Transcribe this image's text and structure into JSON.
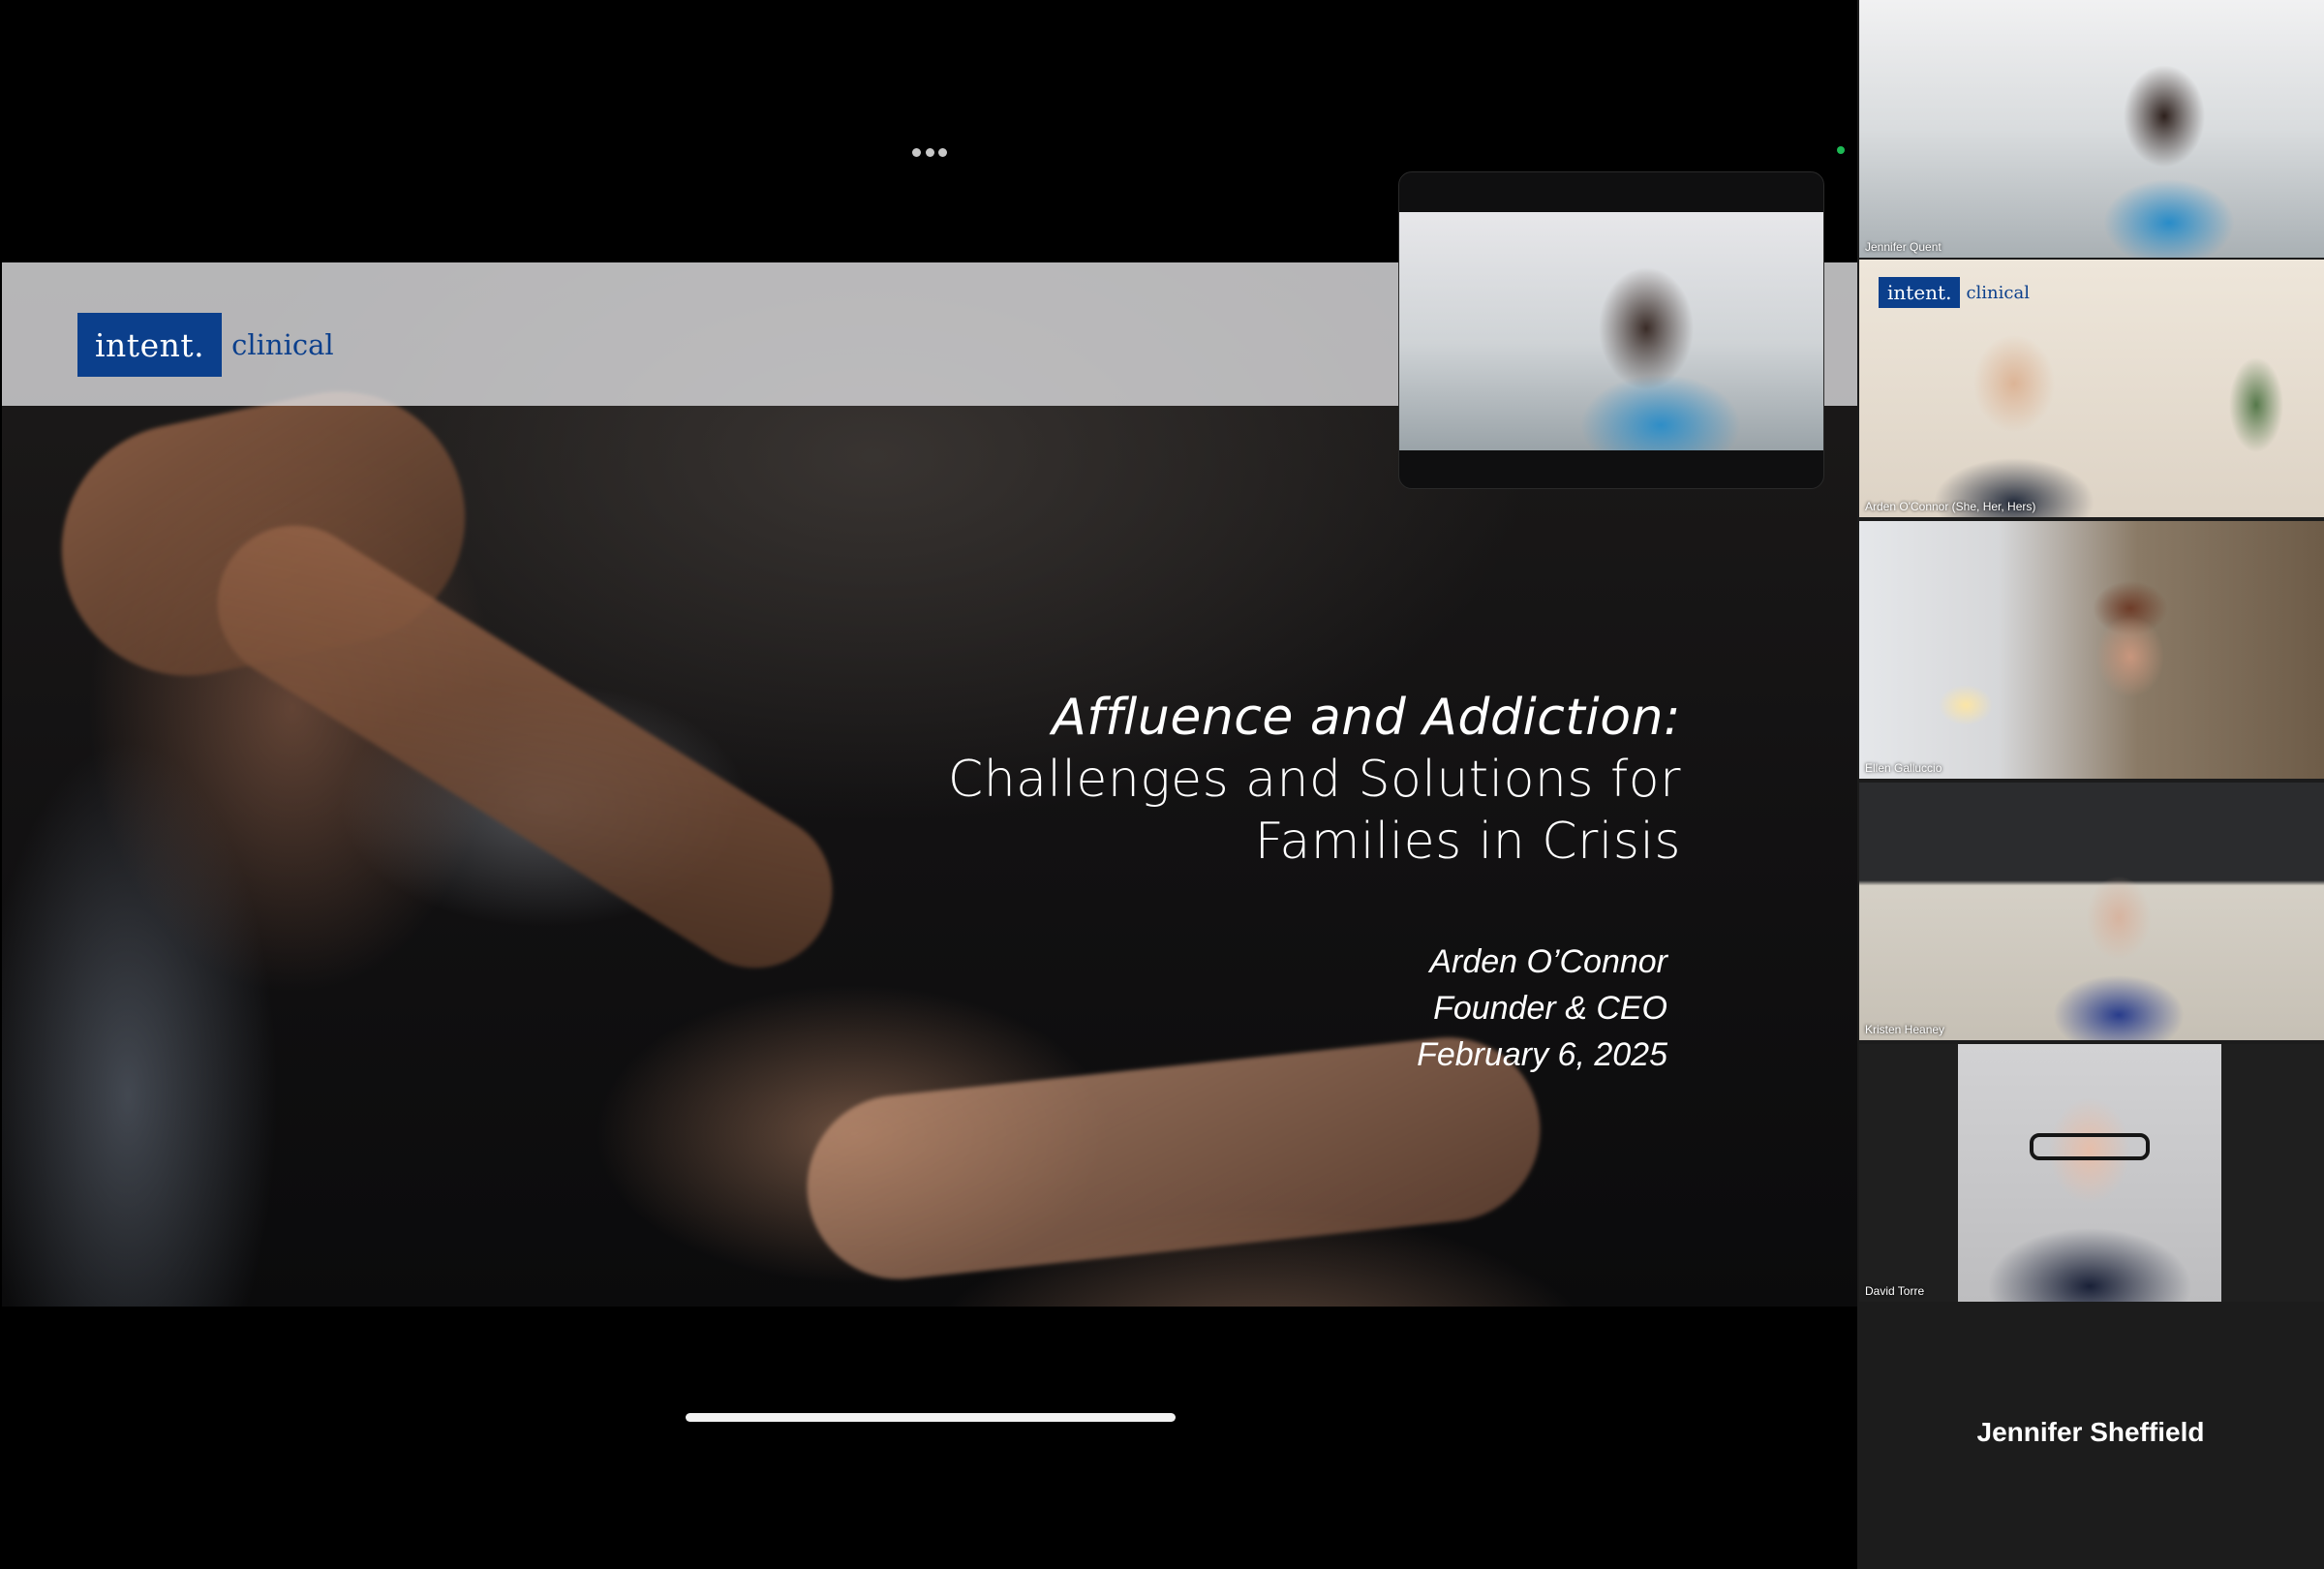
{
  "slide": {
    "logo": {
      "mark": "intent.",
      "suffix": "clinical"
    },
    "title": {
      "line1": "Affluence and Addiction:",
      "line2": "Challenges and Solutions for",
      "line3": "Families in Crisis"
    },
    "byline": {
      "name": "Arden O’Connor",
      "role": "Founder & CEO",
      "date": "February 6, 2025"
    }
  },
  "gallery": {
    "participants": [
      {
        "name": "Jennifer Quent"
      },
      {
        "name": "Arden O'Connor (She, Her, Hers)",
        "background_logo_mark": "intent.",
        "background_logo_suffix": "clinical"
      },
      {
        "name": "Ellen Galluccio"
      },
      {
        "name": "Kristen Heaney"
      },
      {
        "name": "David Torre"
      }
    ],
    "active_speaker": "Jennifer Sheffield"
  },
  "colors": {
    "brand_blue": "#0b3f8c",
    "status_green": "#1db954",
    "gallery_bg": "#1c1c1c"
  },
  "icons": {
    "more_options": "more-horizontal-icon"
  }
}
